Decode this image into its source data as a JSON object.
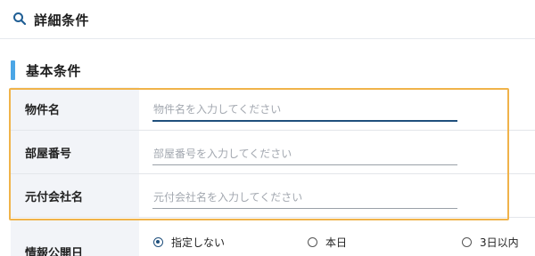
{
  "header": {
    "title": "詳細条件",
    "icon": "search-icon"
  },
  "section": {
    "title": "基本条件"
  },
  "fields": [
    {
      "label": "物件名",
      "placeholder": "物件名を入力してください"
    },
    {
      "label": "部屋番号",
      "placeholder": "部屋番号を入力してください"
    },
    {
      "label": "元付会社名",
      "placeholder": "元付会社名を入力してください"
    }
  ],
  "info_date": {
    "label": "情報公開日",
    "options": [
      {
        "label": "指定しない",
        "selected": true
      },
      {
        "label": "本日",
        "selected": false
      },
      {
        "label": "3日以内",
        "selected": false
      }
    ]
  },
  "colors": {
    "accent": "#4ba6e6",
    "highlight": "#f0b34a",
    "primary": "#1f4f7c"
  }
}
